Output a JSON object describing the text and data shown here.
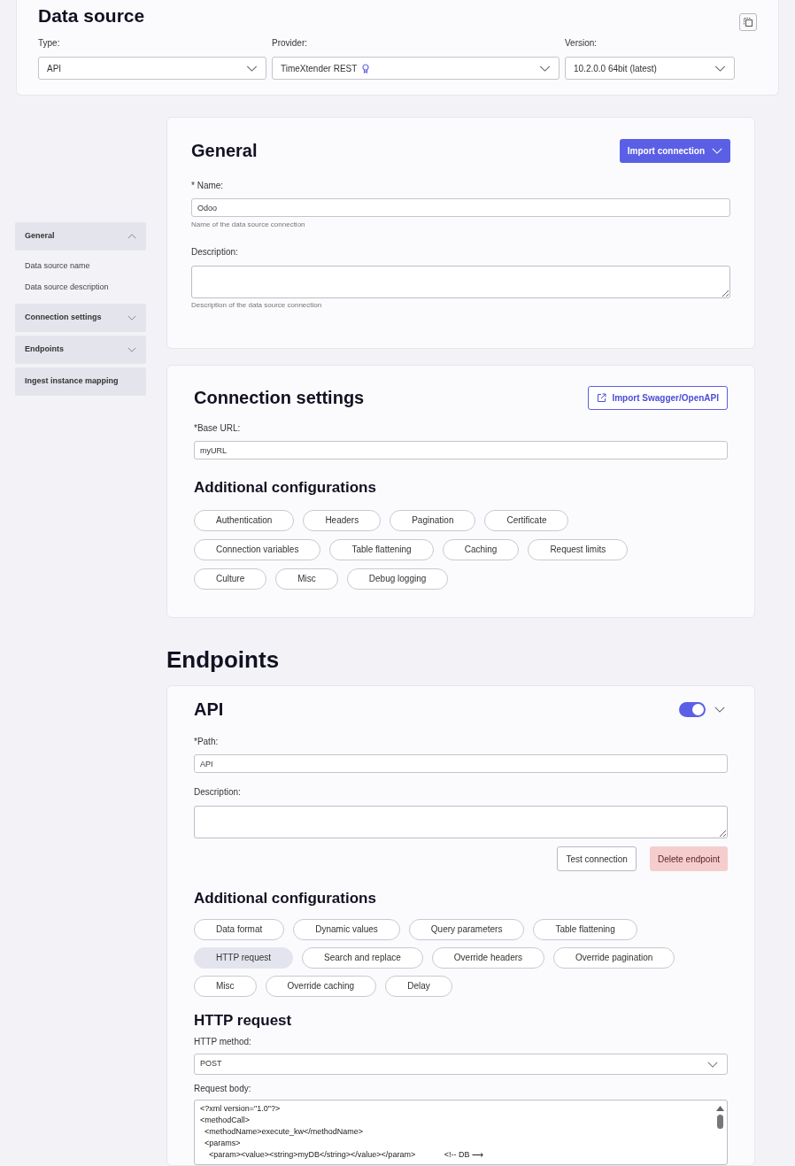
{
  "data_source": {
    "title": "Data source",
    "fields": [
      {
        "label": "Type:",
        "value": "API",
        "badge": false
      },
      {
        "label": "Provider:",
        "value": "TimeXtender REST",
        "badge": true
      },
      {
        "label": "Version:",
        "value": "10.2.0.0 64bit (latest)",
        "badge": false
      }
    ]
  },
  "sidebar": {
    "items": [
      {
        "label": "General",
        "expanded": true,
        "children": [
          {
            "label": "Data source name"
          },
          {
            "label": "Data source description"
          }
        ]
      },
      {
        "label": "Connection settings",
        "expanded": false
      },
      {
        "label": "Endpoints",
        "expanded": false
      },
      {
        "label": "Ingest instance mapping"
      }
    ]
  },
  "general": {
    "title": "General",
    "import_button": "Import connection",
    "name_label": "* Name:",
    "name_value": "Odoo",
    "name_help": "Name of the data source connection",
    "description_label": "Description:",
    "description_help": "Description of the data source connection"
  },
  "connection_settings": {
    "title": "Connection settings",
    "import_button": "Import Swagger/OpenAPI",
    "base_url_label": "*Base URL:",
    "base_url_value": "myURL",
    "additional_title": "Additional configurations",
    "chips": [
      [
        {
          "label": "Authentication",
          "selected": false
        },
        {
          "label": "Headers",
          "selected": false
        },
        {
          "label": "Pagination",
          "selected": false
        },
        {
          "label": "Certificate",
          "selected": false
        }
      ],
      [
        {
          "label": "Connection variables",
          "selected": false
        },
        {
          "label": "Table flattening",
          "selected": false
        },
        {
          "label": "Caching",
          "selected": false
        },
        {
          "label": "Request limits",
          "selected": false
        }
      ],
      [
        {
          "label": "Culture",
          "selected": false
        },
        {
          "label": "Misc",
          "selected": false
        },
        {
          "label": "Debug logging",
          "selected": false
        }
      ]
    ]
  },
  "endpoints": {
    "title": "Endpoints",
    "endpoint": {
      "title": "API",
      "enabled": true,
      "path_label": "*Path:",
      "path_value": "API",
      "description_label": "Description:",
      "test_button": "Test connection",
      "delete_button": "Delete endpoint",
      "additional_title": "Additional configurations",
      "chips": [
        [
          {
            "label": "Data format",
            "selected": false
          },
          {
            "label": "Dynamic values",
            "selected": false
          },
          {
            "label": "Query parameters",
            "selected": false
          },
          {
            "label": "Table flattening",
            "selected": false
          }
        ],
        [
          {
            "label": "HTTP request",
            "selected": true
          },
          {
            "label": "Search and replace",
            "selected": false
          },
          {
            "label": "Override headers",
            "selected": false
          },
          {
            "label": "Override pagination",
            "selected": false
          }
        ],
        [
          {
            "label": "Misc",
            "selected": false
          },
          {
            "label": "Override caching",
            "selected": false
          },
          {
            "label": "Delay",
            "selected": false
          }
        ]
      ],
      "http_request": {
        "title": "HTTP request",
        "method_label": "HTTP method:",
        "method_value": "POST",
        "body_label": "Request body:",
        "body_lines": [
          "<?xml version=\"1.0\"?>",
          "<methodCall>",
          "  <methodName>execute_kw</methodName>",
          "  <params>",
          "    <param><value><string>myDB</string></value></param>             <!-- DB ⟶"
        ]
      }
    }
  }
}
